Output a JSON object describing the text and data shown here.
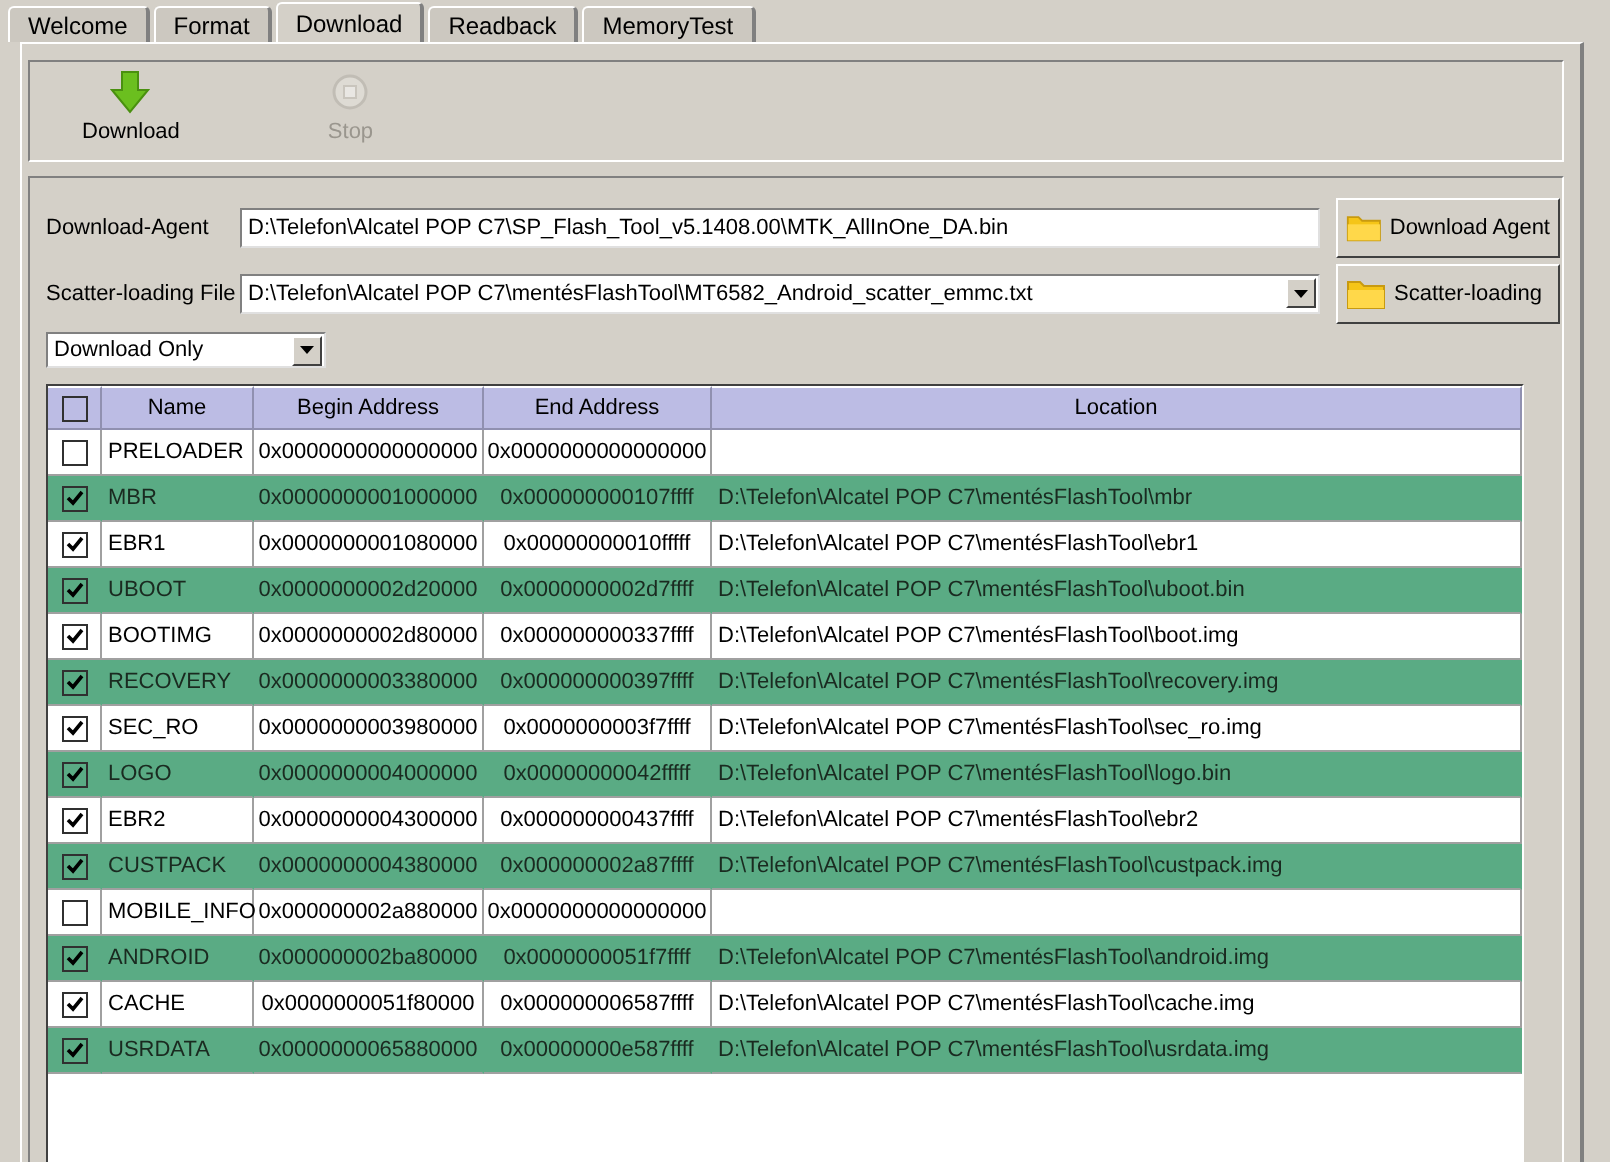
{
  "tabs": [
    {
      "label": "Welcome",
      "selected": false
    },
    {
      "label": "Format",
      "selected": false
    },
    {
      "label": "Download",
      "selected": true
    },
    {
      "label": "Readback",
      "selected": false
    },
    {
      "label": "MemoryTest",
      "selected": false
    }
  ],
  "toolbar": [
    {
      "kind": "download",
      "label": "Download",
      "disabled": false
    },
    {
      "kind": "stop",
      "label": "Stop",
      "disabled": true
    }
  ],
  "download_agent": {
    "label": "Download-Agent",
    "value": "D:\\Telefon\\Alcatel POP C7\\SP_Flash_Tool_v5.1408.00\\MTK_AllInOne_DA.bin",
    "button": "Download Agent"
  },
  "scatter_file": {
    "label": "Scatter-loading File",
    "value": "D:\\Telefon\\Alcatel POP C7\\mentésFlashTool\\MT6582_Android_scatter_emmc.txt",
    "button": "Scatter-loading"
  },
  "mode": {
    "value": "Download Only"
  },
  "table": {
    "all_checked": false,
    "columns": [
      "Name",
      "Begin Address",
      "End Address",
      "Location"
    ],
    "rows": [
      {
        "checked": false,
        "name": "PRELOADER",
        "begin": "0x0000000000000000",
        "end": "0x0000000000000000",
        "location": ""
      },
      {
        "checked": true,
        "name": "MBR",
        "begin": "0x0000000001000000",
        "end": "0x000000000107ffff",
        "location": "D:\\Telefon\\Alcatel POP C7\\mentésFlashTool\\mbr"
      },
      {
        "checked": true,
        "name": "EBR1",
        "begin": "0x0000000001080000",
        "end": "0x00000000010fffff",
        "location": "D:\\Telefon\\Alcatel POP C7\\mentésFlashTool\\ebr1"
      },
      {
        "checked": true,
        "name": "UBOOT",
        "begin": "0x0000000002d20000",
        "end": "0x0000000002d7ffff",
        "location": "D:\\Telefon\\Alcatel POP C7\\mentésFlashTool\\uboot.bin"
      },
      {
        "checked": true,
        "name": "BOOTIMG",
        "begin": "0x0000000002d80000",
        "end": "0x000000000337ffff",
        "location": "D:\\Telefon\\Alcatel POP C7\\mentésFlashTool\\boot.img"
      },
      {
        "checked": true,
        "name": "RECOVERY",
        "begin": "0x0000000003380000",
        "end": "0x000000000397ffff",
        "location": "D:\\Telefon\\Alcatel POP C7\\mentésFlashTool\\recovery.img"
      },
      {
        "checked": true,
        "name": "SEC_RO",
        "begin": "0x0000000003980000",
        "end": "0x0000000003f7ffff",
        "location": "D:\\Telefon\\Alcatel POP C7\\mentésFlashTool\\sec_ro.img"
      },
      {
        "checked": true,
        "name": "LOGO",
        "begin": "0x0000000004000000",
        "end": "0x00000000042fffff",
        "location": "D:\\Telefon\\Alcatel POP C7\\mentésFlashTool\\logo.bin"
      },
      {
        "checked": true,
        "name": "EBR2",
        "begin": "0x0000000004300000",
        "end": "0x000000000437ffff",
        "location": "D:\\Telefon\\Alcatel POP C7\\mentésFlashTool\\ebr2"
      },
      {
        "checked": true,
        "name": "CUSTPACK",
        "begin": "0x0000000004380000",
        "end": "0x000000002a87ffff",
        "location": "D:\\Telefon\\Alcatel POP C7\\mentésFlashTool\\custpack.img"
      },
      {
        "checked": false,
        "name": "MOBILE_INFO",
        "begin": "0x000000002a880000",
        "end": "0x0000000000000000",
        "location": ""
      },
      {
        "checked": true,
        "name": "ANDROID",
        "begin": "0x000000002ba80000",
        "end": "0x0000000051f7ffff",
        "location": "D:\\Telefon\\Alcatel POP C7\\mentésFlashTool\\android.img"
      },
      {
        "checked": true,
        "name": "CACHE",
        "begin": "0x0000000051f80000",
        "end": "0x000000006587ffff",
        "location": "D:\\Telefon\\Alcatel POP C7\\mentésFlashTool\\cache.img"
      },
      {
        "checked": true,
        "name": "USRDATA",
        "begin": "0x0000000065880000",
        "end": "0x00000000e587ffff",
        "location": "D:\\Telefon\\Alcatel POP C7\\mentésFlashTool\\usrdata.img"
      }
    ]
  }
}
